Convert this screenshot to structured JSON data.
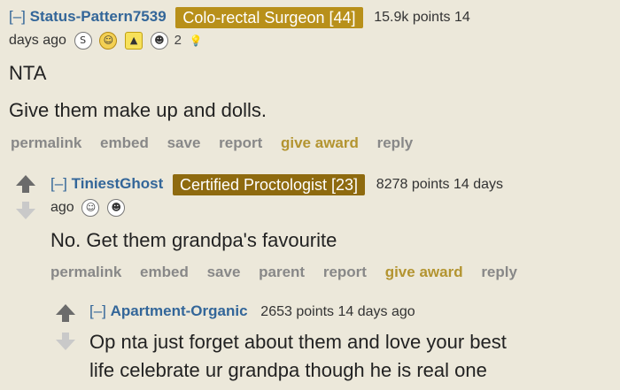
{
  "comments": [
    {
      "toggle": "[–]",
      "author": "Status-Pattern7539",
      "flair": "Colo-rectal Surgeon [44]",
      "flair_color": "#b8901a",
      "score_line1": "15.9k points 14",
      "score_line2": "days ago",
      "award_count": "2",
      "body": [
        "NTA",
        "Give them make up and dolls."
      ],
      "buttons": [
        "permalink",
        "embed",
        "save",
        "report",
        "give award",
        "reply"
      ]
    },
    {
      "toggle": "[–]",
      "author": "TiniestGhost",
      "flair": "Certified Proctologist [23]",
      "flair_color": "#8e6a0f",
      "score_line1": "8278 points 14 days",
      "score_line2": "ago",
      "body": [
        "No. Get them grandpa's favourite"
      ],
      "buttons": [
        "permalink",
        "embed",
        "save",
        "parent",
        "report",
        "give award",
        "reply"
      ]
    },
    {
      "toggle": "[–]",
      "author": "Apartment-Organic",
      "score": "2653 points 14 days ago",
      "body": [
        "Op nta just forget about them and love your best",
        "life celebrate ur grandpa though he is real one"
      ]
    }
  ]
}
